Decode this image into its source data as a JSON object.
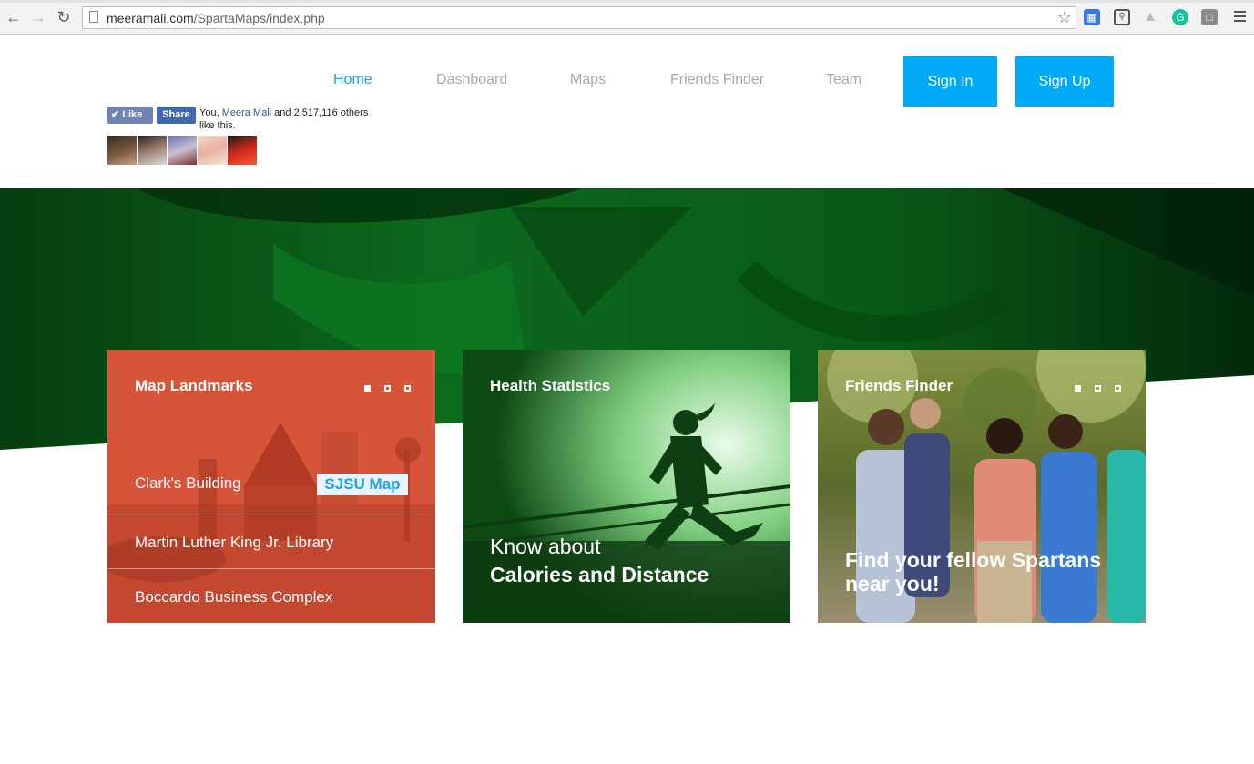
{
  "browser": {
    "url_host": "meeramali.com",
    "url_path": "/SpartaMaps/index.php"
  },
  "nav": {
    "items": [
      "Home",
      "Dashboard",
      "Maps",
      "Friends Finder",
      "Team"
    ],
    "sign_in": "Sign In",
    "sign_up": "Sign Up"
  },
  "facebook": {
    "like_label": "Like",
    "share_label": "Share",
    "text_prefix": "You,",
    "friend_name": "Meera Mali",
    "text_suffix": "and 2,517,116 others like this."
  },
  "cards": {
    "landmarks": {
      "title": "Map Landmarks",
      "items": [
        "Clark's Building",
        "Martin Luther King Jr. Library",
        "Boccardo Business Complex"
      ],
      "map_button": "SJSU Map"
    },
    "health": {
      "title": "Health Statistics",
      "line1": "Know about",
      "line2": "Calories and Distance"
    },
    "friends": {
      "title": "Friends Finder",
      "tagline": "Find your fellow Spartans near you!"
    }
  },
  "colors": {
    "accent": "#00aaf7",
    "landmarks_bg": "#d6553a",
    "hero_green": "#0b6b1c"
  }
}
